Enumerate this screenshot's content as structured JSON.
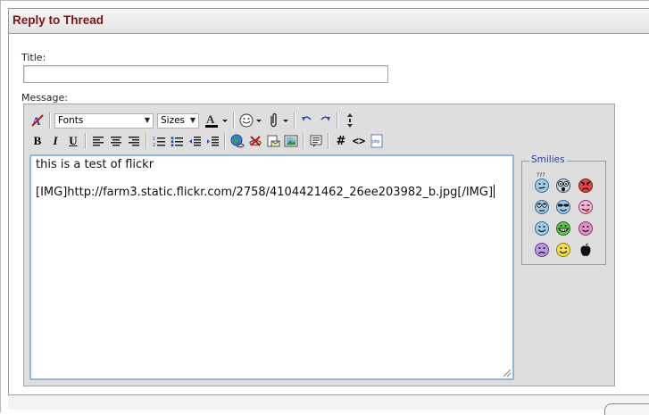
{
  "header": {
    "title": "Reply to Thread"
  },
  "form": {
    "title_label": "Title:",
    "title_value": "",
    "message_label": "Message:"
  },
  "toolbar": {
    "font_value": "Fonts",
    "size_value": "Sizes",
    "bold": "B",
    "italic": "I",
    "underline": "U",
    "hash": "#",
    "code": "<>"
  },
  "message": {
    "line1": "this is a test of flickr",
    "line2": "[IMG]http://farm3.static.flickr.com/2758/4104421462_26ee203982_b.jpg[/IMG]"
  },
  "smilies": {
    "legend": "Smilies",
    "items": [
      "confused",
      "frown",
      "mad",
      "redface",
      "cool",
      "tongue",
      "smile",
      "biggrin",
      "eek",
      "rolleyes",
      "wink",
      "apple"
    ]
  },
  "colors": {
    "header_text": "#7a1515",
    "smilies_legend": "#2b3a9c",
    "textarea_border": "#8fb6de"
  }
}
